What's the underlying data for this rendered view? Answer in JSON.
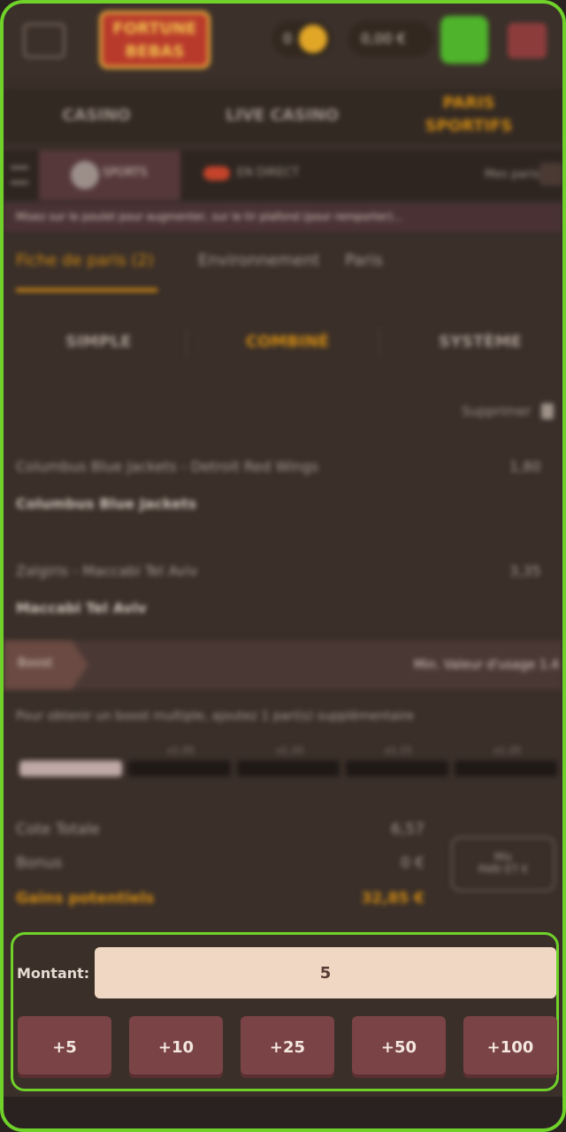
{
  "header": {
    "brand": "FORTUNE\nBEBAS",
    "coin_count": "0",
    "balance": "0,00 €"
  },
  "main_tabs": [
    {
      "label": "CASINO"
    },
    {
      "label": "LIVE CASINO"
    },
    {
      "label": "PARIS\nSPORTIFS"
    }
  ],
  "subnav": {
    "sports": "SPORTS",
    "live": "EN DIRECT",
    "my_bets": "Mes paris"
  },
  "info_bar": "Misez sur le poulet pour augmenter, sur le tir plafond (pour remporter)...",
  "betslip_tabs": [
    {
      "label": "Fiche de paris (2)"
    },
    {
      "label": "Environnement"
    },
    {
      "label": "Paris"
    }
  ],
  "modes": [
    {
      "label": "SIMPLE"
    },
    {
      "label": "COMBINÉ"
    },
    {
      "label": "SYSTÈME"
    }
  ],
  "clear_all": "Supprimer",
  "selections": [
    {
      "match": "Columbus Blue Jackets - Detroit Red Wings",
      "pick": "Columbus Blue Jackets",
      "odd": "1,80"
    },
    {
      "match": "Zalgiris - Maccabi Tel Aviv",
      "pick": "Maccabi Tel Aviv",
      "odd": "3,35"
    }
  ],
  "boost": {
    "label": "Boost",
    "right": "Min. Valeur d'usage 1.4",
    "info": "Pour obtenir un boost multiple, ajoutez 1 pari(s) supplémentaire",
    "segments": [
      {
        "label": ""
      },
      {
        "label": "x1.05"
      },
      {
        "label": "x1.10"
      },
      {
        "label": "x1.15"
      },
      {
        "label": "x1.20"
      }
    ],
    "progress": 0.2
  },
  "summary": {
    "total_odds_label": "Cote Totale",
    "total_odds": "6,57",
    "bonus_label": "Bonus",
    "bonus": "0 €",
    "gain_label": "Gains potentiels",
    "gain": "32,85 €",
    "place_label": "Mis\nPARI ET €"
  },
  "stake": {
    "label": "Montant:",
    "value": "5",
    "quick": [
      "+5",
      "+10",
      "+25",
      "+50",
      "+100"
    ]
  },
  "colors": {
    "accent": "#d18b13",
    "highlight": "#6fd12a",
    "button": "#7a4346",
    "input_bg": "#efd7c3"
  }
}
